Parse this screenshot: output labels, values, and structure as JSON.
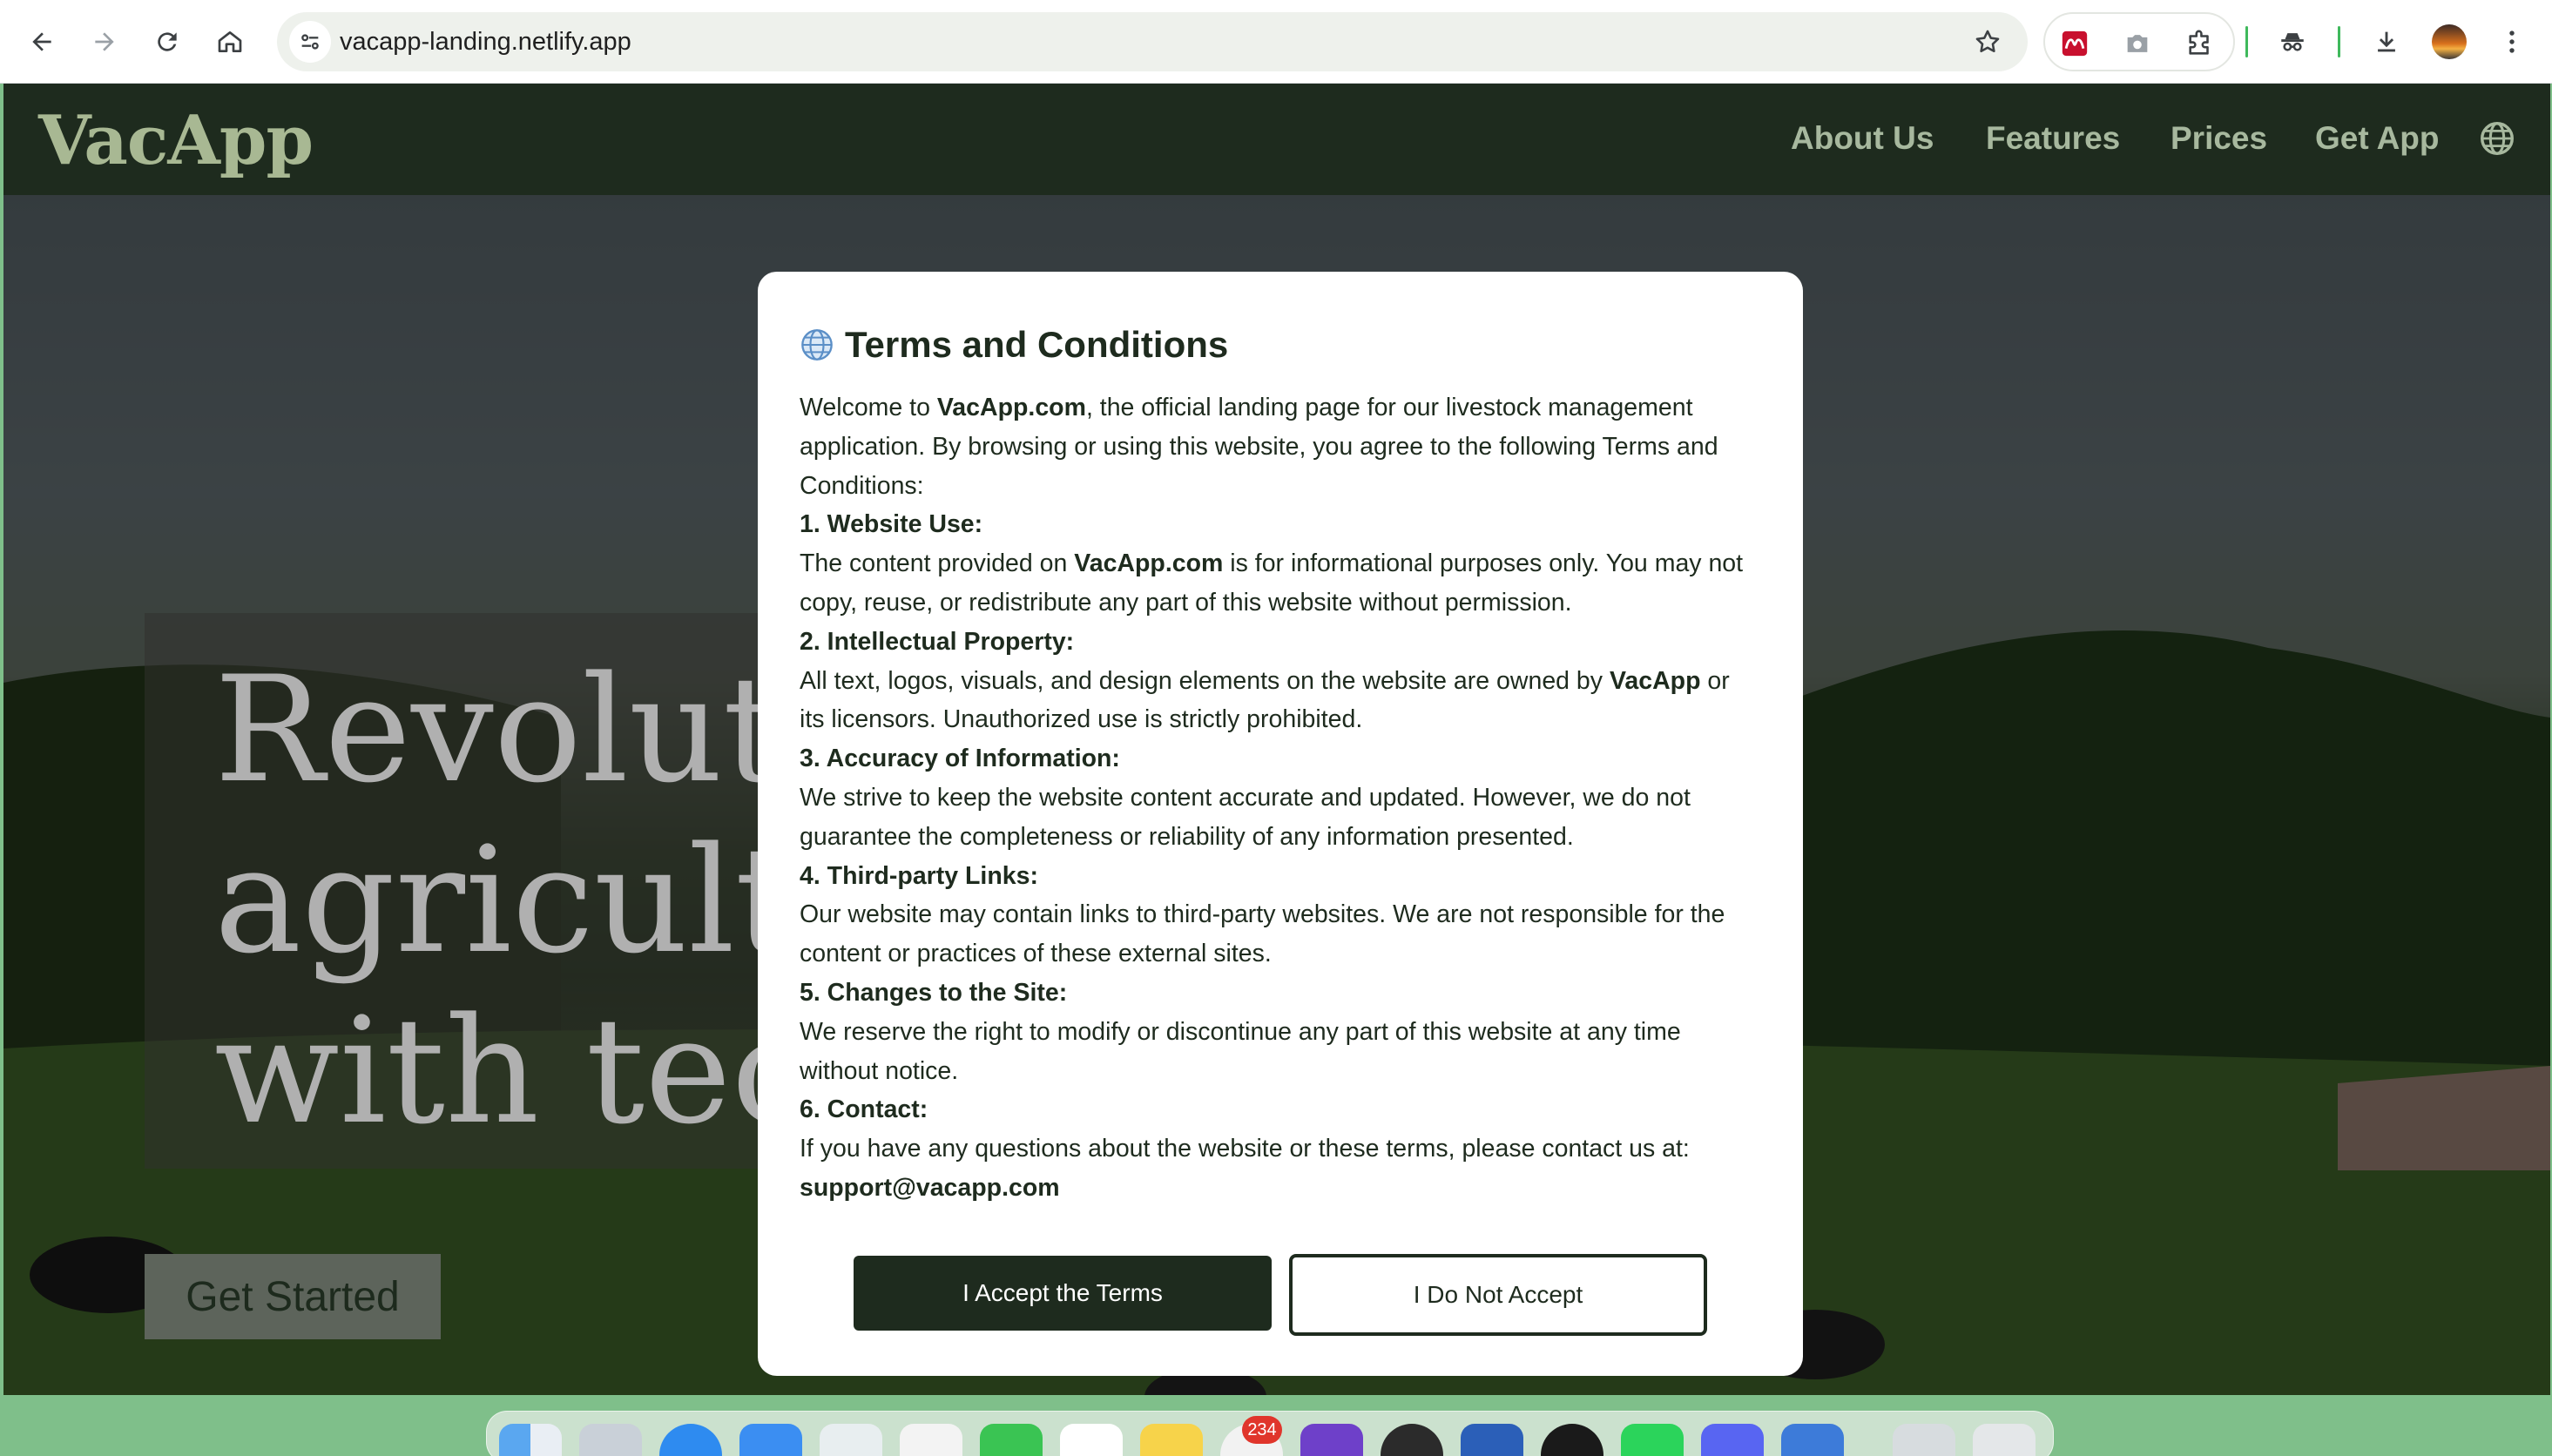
{
  "browser": {
    "url": "vacapp-landing.netlify.app",
    "back_icon": "arrow-left",
    "forward_icon": "arrow-right",
    "reload_icon": "reload",
    "home_icon": "home",
    "bookmark_icon": "star"
  },
  "site": {
    "logo": "VacApp",
    "nav": [
      "About Us",
      "Features",
      "Prices",
      "Get App"
    ],
    "hero_title_lines": [
      "Revoluti",
      "agricultu",
      "with tec"
    ],
    "cta": "Get Started",
    "brand_color": "#1e2b1e"
  },
  "modal": {
    "title": "Terms and Conditions",
    "intro_pre": "Welcome to ",
    "intro_brand": "VacApp.com",
    "intro_post": ", the official landing page for our livestock management application. By browsing or using this website, you agree to the following Terms and Conditions:",
    "s1_title": "1. Website Use:",
    "s1_pre": "The content provided on ",
    "s1_brand": "VacApp.com",
    "s1_post": " is for informational purposes only. You may not copy, reuse, or redistribute any part of this website without permission.",
    "s2_title": "2. Intellectual Property:",
    "s2_pre": "All text, logos, visuals, and design elements on the website are owned by ",
    "s2_brand": "VacApp",
    "s2_post": " or its licensors. Unauthorized use is strictly prohibited.",
    "s3_title": "3. Accuracy of Information:",
    "s3_body": "We strive to keep the website content accurate and updated. However, we do not guarantee the completeness or reliability of any information presented.",
    "s4_title": "4. Third-party Links:",
    "s4_body": "Our website may contain links to third-party websites. We are not responsible for the content or practices of these external sites.",
    "s5_title": "5. Changes to the Site:",
    "s5_body": "We reserve the right to modify or discontinue any part of this website at any time without notice.",
    "s6_title": "6. Contact:",
    "s6_body": "If you have any questions about the website or these terms, please contact us at:",
    "contact_email": "support@vacapp.com",
    "accept_label": "I Accept the Terms",
    "decline_label": "I Do Not Accept"
  },
  "dock": {
    "badge": "234"
  }
}
